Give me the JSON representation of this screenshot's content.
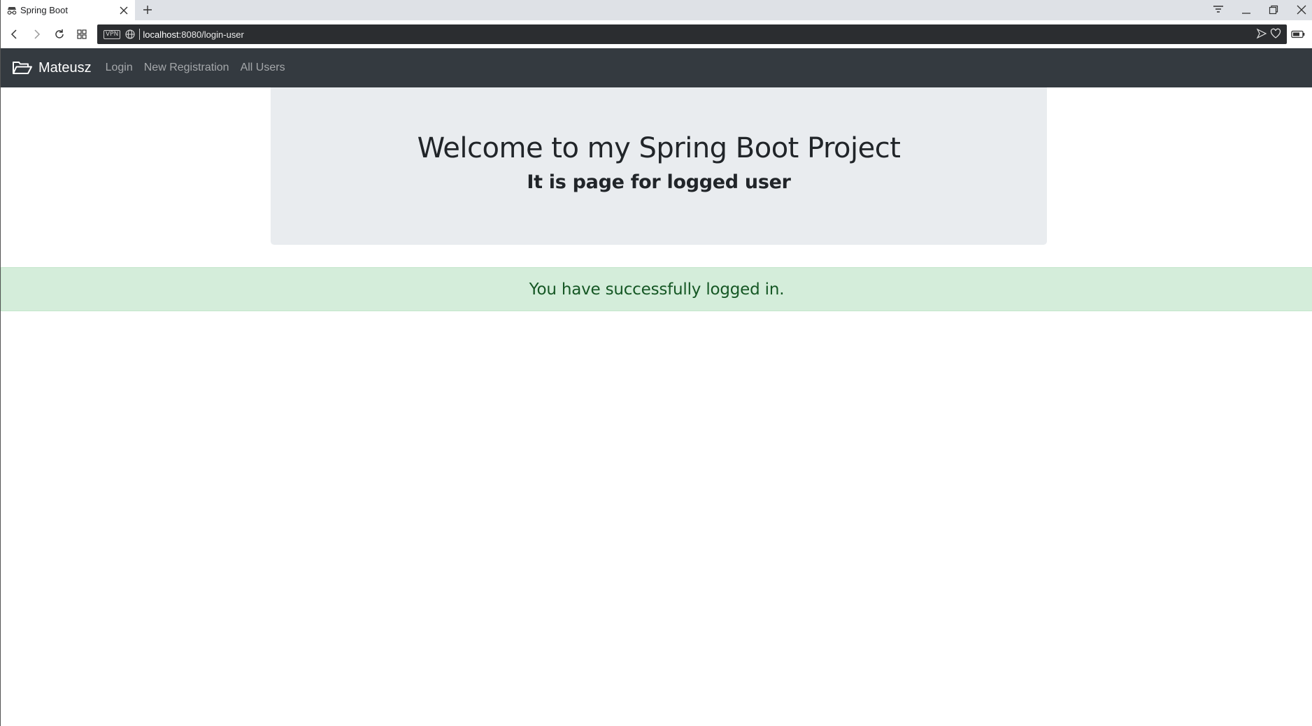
{
  "browser": {
    "tab_title": "Spring Boot",
    "url_host": "localhost",
    "url_path": ":8080/login-user",
    "vpn_label": "VPN"
  },
  "navbar": {
    "brand": "Mateusz",
    "links": [
      {
        "label": "Login"
      },
      {
        "label": "New Registration"
      },
      {
        "label": "All Users"
      }
    ]
  },
  "jumbotron": {
    "title": "Welcome to my Spring Boot Project",
    "subtitle": "It is page for logged user"
  },
  "alert": {
    "message": "You have successfully logged in."
  },
  "colors": {
    "navbar_bg": "#343a40",
    "jumbotron_bg": "#e9ecef",
    "alert_bg": "#d4edda",
    "alert_text": "#155724"
  }
}
